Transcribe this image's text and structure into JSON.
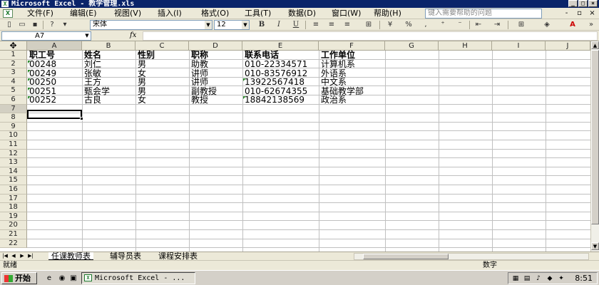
{
  "window": {
    "title": "Microsoft Excel - 教学管理.xls",
    "controls": [
      "_",
      "□",
      "×"
    ]
  },
  "menubar": {
    "items": [
      "文件(F)",
      "编辑(E)",
      "视图(V)",
      "插入(I)",
      "格式(O)",
      "工具(T)",
      "数据(D)",
      "窗口(W)",
      "帮助(H)"
    ],
    "help_placeholder": "键入需要帮助的问题",
    "doc_controls": [
      "-",
      "▫",
      "×"
    ]
  },
  "toolbar": {
    "font_name": "宋体",
    "font_size": "12",
    "bold": "B",
    "italic": "I",
    "underline": "U",
    "percent": "%",
    "comma": ","
  },
  "formula_bar": {
    "name_box": "A7",
    "fx": "fx",
    "content": ""
  },
  "sheet": {
    "columns": [
      "A",
      "B",
      "C",
      "D",
      "E",
      "F",
      "G",
      "H",
      "I",
      "J"
    ],
    "rows": [
      "1",
      "2",
      "3",
      "4",
      "5",
      "6",
      "7",
      "8",
      "9",
      "10",
      "11",
      "12",
      "13",
      "14",
      "15",
      "16",
      "17",
      "18",
      "19",
      "20",
      "21",
      "22"
    ],
    "headers": [
      "职工号",
      "姓名",
      "性别",
      "职称",
      "联系电话",
      "工作单位"
    ],
    "data": [
      [
        "00248",
        "刘仁",
        "男",
        "助教",
        "010-22334571",
        "计算机系"
      ],
      [
        "00249",
        "张敏",
        "女",
        "讲师",
        "010-83576912",
        "外语系"
      ],
      [
        "00250",
        "王方",
        "男",
        "讲师",
        "13922567418",
        "中文系"
      ],
      [
        "00251",
        "甄会学",
        "男",
        "副教授",
        "010-62674355",
        "基础教学部"
      ],
      [
        "00252",
        "古良",
        "女",
        "教授",
        "18842138569",
        "政治系"
      ]
    ],
    "active_cell": "A7"
  },
  "tabs": {
    "items": [
      "任课教师表",
      "辅导员表",
      "课程安排表"
    ],
    "active": "任课教师表"
  },
  "status": {
    "ready": "就绪",
    "mode": "数字"
  },
  "taskbar": {
    "start": "开始",
    "task": "Microsoft Excel - ...",
    "clock": "8:51"
  }
}
